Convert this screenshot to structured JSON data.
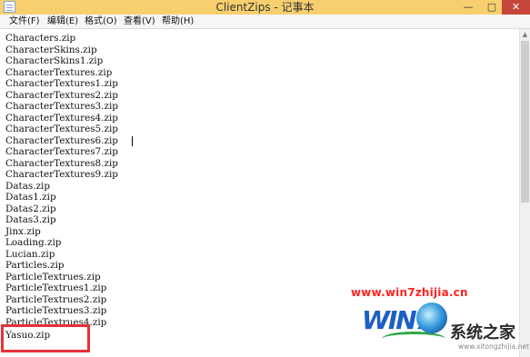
{
  "window": {
    "title": "ClientZips - 记事本",
    "minimize_glyph": "—",
    "maximize_glyph": "▢",
    "close_glyph": "✕"
  },
  "menu": [
    {
      "id": "file",
      "label": "文件(F)"
    },
    {
      "id": "edit",
      "label": "编辑(E)"
    },
    {
      "id": "format",
      "label": "格式(O)"
    },
    {
      "id": "view",
      "label": "查看(V)"
    },
    {
      "id": "help",
      "label": "帮助(H)"
    }
  ],
  "editor": {
    "lines": [
      "Characters.zip",
      "CharacterSkins.zip",
      "CharacterSkins1.zip",
      "CharacterTextures.zip",
      "CharacterTextures1.zip",
      "CharacterTextures2.zip",
      "CharacterTextures3.zip",
      "CharacterTextures4.zip",
      "CharacterTextures5.zip",
      "CharacterTextures6.zip",
      "CharacterTextures7.zip",
      "CharacterTextures8.zip",
      "CharacterTextures9.zip",
      "Datas.zip",
      "Datas1.zip",
      "Datas2.zip",
      "Datas3.zip",
      "Jinx.zip",
      "Loading.zip",
      "Lucian.zip",
      "Particles.zip",
      "ParticleTextrues.zip",
      "ParticleTextrues1.zip",
      "ParticleTextrues2.zip",
      "ParticleTextrues3.zip",
      "ParticleTextrues4.zip",
      "Yasuo.zip"
    ]
  },
  "scrollbar": {
    "up_glyph": "▲"
  },
  "watermark": {
    "url": "www.win7zhijia.cn",
    "logo_text": "WIN7",
    "brand": "系统之家",
    "domain": "www.xitongzhijia.net",
    "colors": {
      "url": "#ff2222",
      "logo": "#1d5fc6",
      "orb_swoosh": "#2fa84a"
    }
  },
  "annotation": {
    "highlight_color": "#e8303a"
  }
}
